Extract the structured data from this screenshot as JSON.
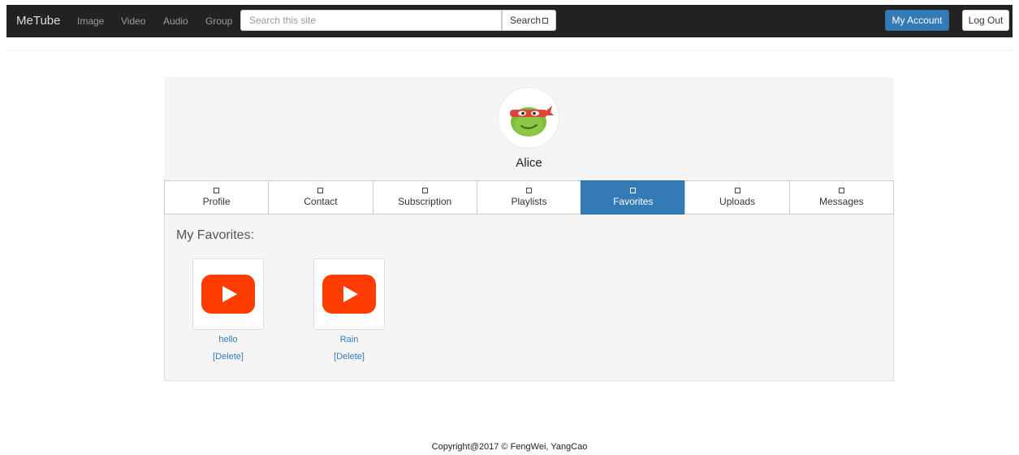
{
  "navbar": {
    "brand": "MeTube",
    "links": [
      "Image",
      "Video",
      "Audio",
      "Group"
    ],
    "search_placeholder": "Search this site",
    "search_label": "Search",
    "account_label": "My Account",
    "logout_label": "Log Out"
  },
  "profile": {
    "username": "Alice"
  },
  "tabs": [
    {
      "label": "Profile",
      "active": false
    },
    {
      "label": "Contact",
      "active": false
    },
    {
      "label": "Subscription",
      "active": false
    },
    {
      "label": "Playlists",
      "active": false
    },
    {
      "label": "Favorites",
      "active": true
    },
    {
      "label": "Uploads",
      "active": false
    },
    {
      "label": "Messages",
      "active": false
    }
  ],
  "favorites": {
    "title": "My Favorites:",
    "items": [
      {
        "title": "hello",
        "delete_label": "[Delete]"
      },
      {
        "title": "Rain",
        "delete_label": "[Delete]"
      }
    ]
  },
  "footer": {
    "copyright": "Copyright@2017 © FengWei, YangCao"
  },
  "colors": {
    "navbar_bg": "#222222",
    "accent": "#337ab7",
    "play_icon": "#ff3d00",
    "panel_bg": "#f5f5f5"
  }
}
